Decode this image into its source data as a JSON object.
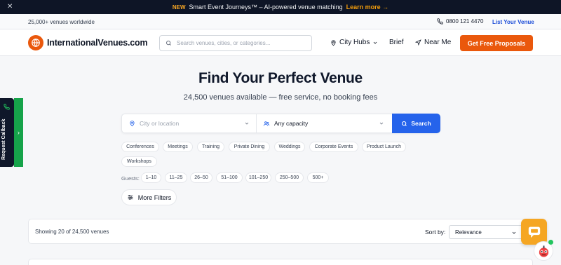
{
  "announcement": {
    "badge": "NEW",
    "message": "Smart Event Journeys™ – AI-powered venue matching",
    "link": "Learn more →",
    "close": "✕"
  },
  "utility": {
    "venue_count": "25,000+ venues worldwide",
    "phone": "0800 121 4470",
    "list_venue": "List Your Venue"
  },
  "header": {
    "logo_text": "InternationalVenues.com",
    "search_placeholder": "Search venues, cities, or categories...",
    "nav": {
      "city_hubs": "City Hubs",
      "brief": "Brief",
      "near_me": "Near Me"
    },
    "cta": "Get Free Proposals"
  },
  "hero": {
    "title": "Find Your Perfect Venue",
    "subtitle": "24,500 venues available — free service, no booking fees"
  },
  "search_bar": {
    "location_placeholder": "City or location",
    "capacity_value": "Any capacity",
    "button": "Search"
  },
  "categories": [
    "Conferences",
    "Meetings",
    "Training",
    "Private Dining",
    "Weddings",
    "Corporate Events",
    "Product Launch",
    "Workshops"
  ],
  "guests": {
    "label": "Guests:",
    "options": [
      "1–10",
      "11–25",
      "26–50",
      "51–100",
      "101–250",
      "250–500",
      "500+"
    ]
  },
  "more_filters": "More Filters",
  "results": {
    "showing": "Showing 20 of 24,500 venues",
    "sort_label": "Sort by:",
    "sort_value": "Relevance"
  },
  "callback": {
    "label": "Request Callback",
    "arrow": "›"
  },
  "colors": {
    "accent_orange": "#ea580c",
    "primary_blue": "#2563eb",
    "dark_navy": "#0e1526",
    "callback_green": "#16a34a",
    "chat_yellow": "#f5a623"
  }
}
